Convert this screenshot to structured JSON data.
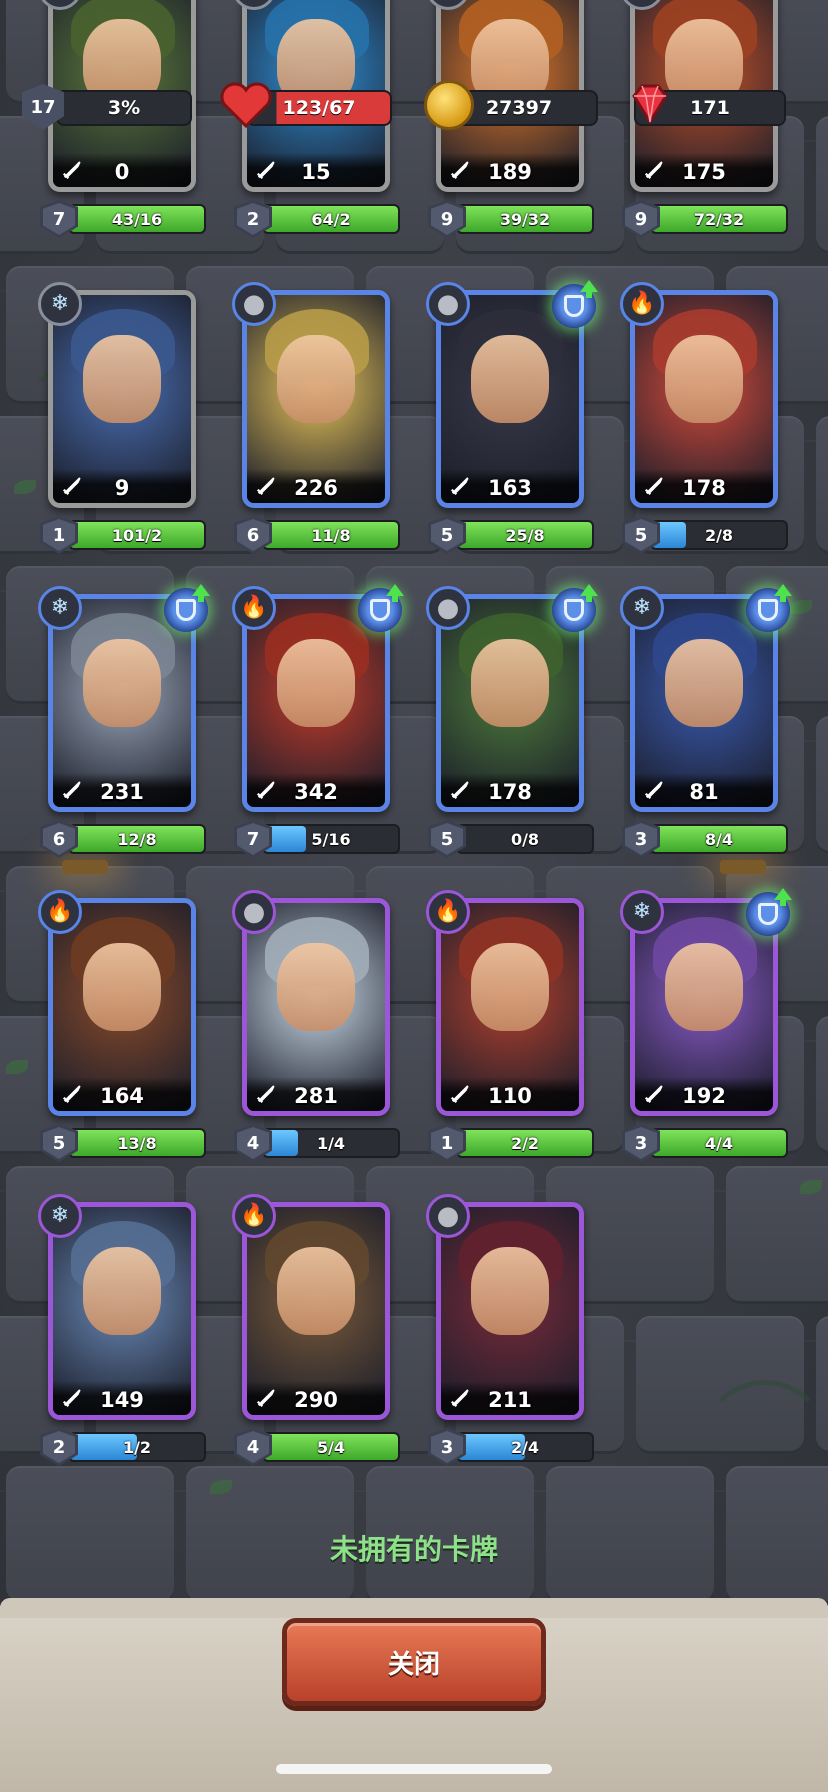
{
  "colors": {
    "rare": "#5a84e6",
    "common": "#9a9a9a",
    "epic": "#9b57d8",
    "bar_green": "#4cc13a",
    "bar_blue": "#3a9be6",
    "caption": "#8ee08a",
    "close_button": "#d25b3c"
  },
  "top_stats": [
    {
      "icon": "shield-level-icon",
      "badge": "17",
      "value": "3%"
    },
    {
      "icon": "heart-icon",
      "value": "123/67"
    },
    {
      "icon": "gold-coin-icon",
      "value": "27397"
    },
    {
      "icon": "ruby-gem-icon",
      "value": "171"
    }
  ],
  "cards": [
    {
      "power": "0",
      "level": "7",
      "progress": "43/16",
      "ratio": 1.0,
      "rarity": "common",
      "element": "",
      "upgrade": false,
      "tint": "#5b7a3a"
    },
    {
      "power": "15",
      "level": "2",
      "progress": "64/2",
      "ratio": 1.0,
      "rarity": "common",
      "element": "ice",
      "upgrade": false,
      "tint": "#2f8fd6"
    },
    {
      "power": "189",
      "level": "9",
      "progress": "39/32",
      "ratio": 1.0,
      "rarity": "common",
      "element": "fire",
      "upgrade": false,
      "tint": "#e0782a"
    },
    {
      "power": "175",
      "level": "9",
      "progress": "72/32",
      "ratio": 1.0,
      "rarity": "common",
      "element": "fire",
      "upgrade": false,
      "tint": "#c4512a"
    },
    {
      "power": "9",
      "level": "1",
      "progress": "101/2",
      "ratio": 1.0,
      "rarity": "common",
      "element": "ice",
      "upgrade": false,
      "tint": "#4a6fb3"
    },
    {
      "power": "226",
      "level": "6",
      "progress": "11/8",
      "ratio": 1.0,
      "rarity": "rare",
      "element": "stone",
      "upgrade": false,
      "tint": "#e6c35a"
    },
    {
      "power": "163",
      "level": "5",
      "progress": "25/8",
      "ratio": 1.0,
      "rarity": "rare",
      "element": "stone",
      "upgrade": true,
      "tint": "#3a3a4a"
    },
    {
      "power": "178",
      "level": "5",
      "progress": "2/8",
      "ratio": 0.25,
      "rarity": "rare",
      "element": "fire",
      "upgrade": false,
      "tint": "#d34a3a"
    },
    {
      "power": "231",
      "level": "6",
      "progress": "12/8",
      "ratio": 1.0,
      "rarity": "rare",
      "element": "ice",
      "upgrade": true,
      "tint": "#9aa6b8"
    },
    {
      "power": "342",
      "level": "7",
      "progress": "5/16",
      "ratio": 0.31,
      "rarity": "rare",
      "element": "fire",
      "upgrade": true,
      "tint": "#c13a2a"
    },
    {
      "power": "178",
      "level": "5",
      "progress": "0/8",
      "ratio": 0.0,
      "rarity": "rare",
      "element": "stone",
      "upgrade": true,
      "tint": "#4d7a3a"
    },
    {
      "power": "81",
      "level": "3",
      "progress": "8/4",
      "ratio": 1.0,
      "rarity": "rare",
      "element": "ice",
      "upgrade": true,
      "tint": "#3a5ab0"
    },
    {
      "power": "164",
      "level": "5",
      "progress": "13/8",
      "ratio": 1.0,
      "rarity": "rare",
      "element": "fire",
      "upgrade": false,
      "tint": "#8a4a2a"
    },
    {
      "power": "281",
      "level": "4",
      "progress": "1/4",
      "ratio": 0.25,
      "rarity": "epic",
      "element": "stone",
      "upgrade": false,
      "tint": "#c9d8e6"
    },
    {
      "power": "110",
      "level": "1",
      "progress": "2/2",
      "ratio": 1.0,
      "rarity": "epic",
      "element": "fire",
      "upgrade": false,
      "tint": "#b3402e"
    },
    {
      "power": "192",
      "level": "3",
      "progress": "4/4",
      "ratio": 1.0,
      "rarity": "epic",
      "element": "ice",
      "upgrade": true,
      "tint": "#8a5ac8"
    },
    {
      "power": "149",
      "level": "2",
      "progress": "1/2",
      "ratio": 0.5,
      "rarity": "epic",
      "element": "ice",
      "upgrade": false,
      "tint": "#6a8ab8"
    },
    {
      "power": "290",
      "level": "4",
      "progress": "5/4",
      "ratio": 1.0,
      "rarity": "epic",
      "element": "fire",
      "upgrade": false,
      "tint": "#7a5a3a"
    },
    {
      "power": "211",
      "level": "3",
      "progress": "2/4",
      "ratio": 0.5,
      "rarity": "epic",
      "element": "stone",
      "upgrade": false,
      "tint": "#7a2a3a"
    }
  ],
  "caption": "未拥有的卡牌",
  "close_label": "关闭"
}
